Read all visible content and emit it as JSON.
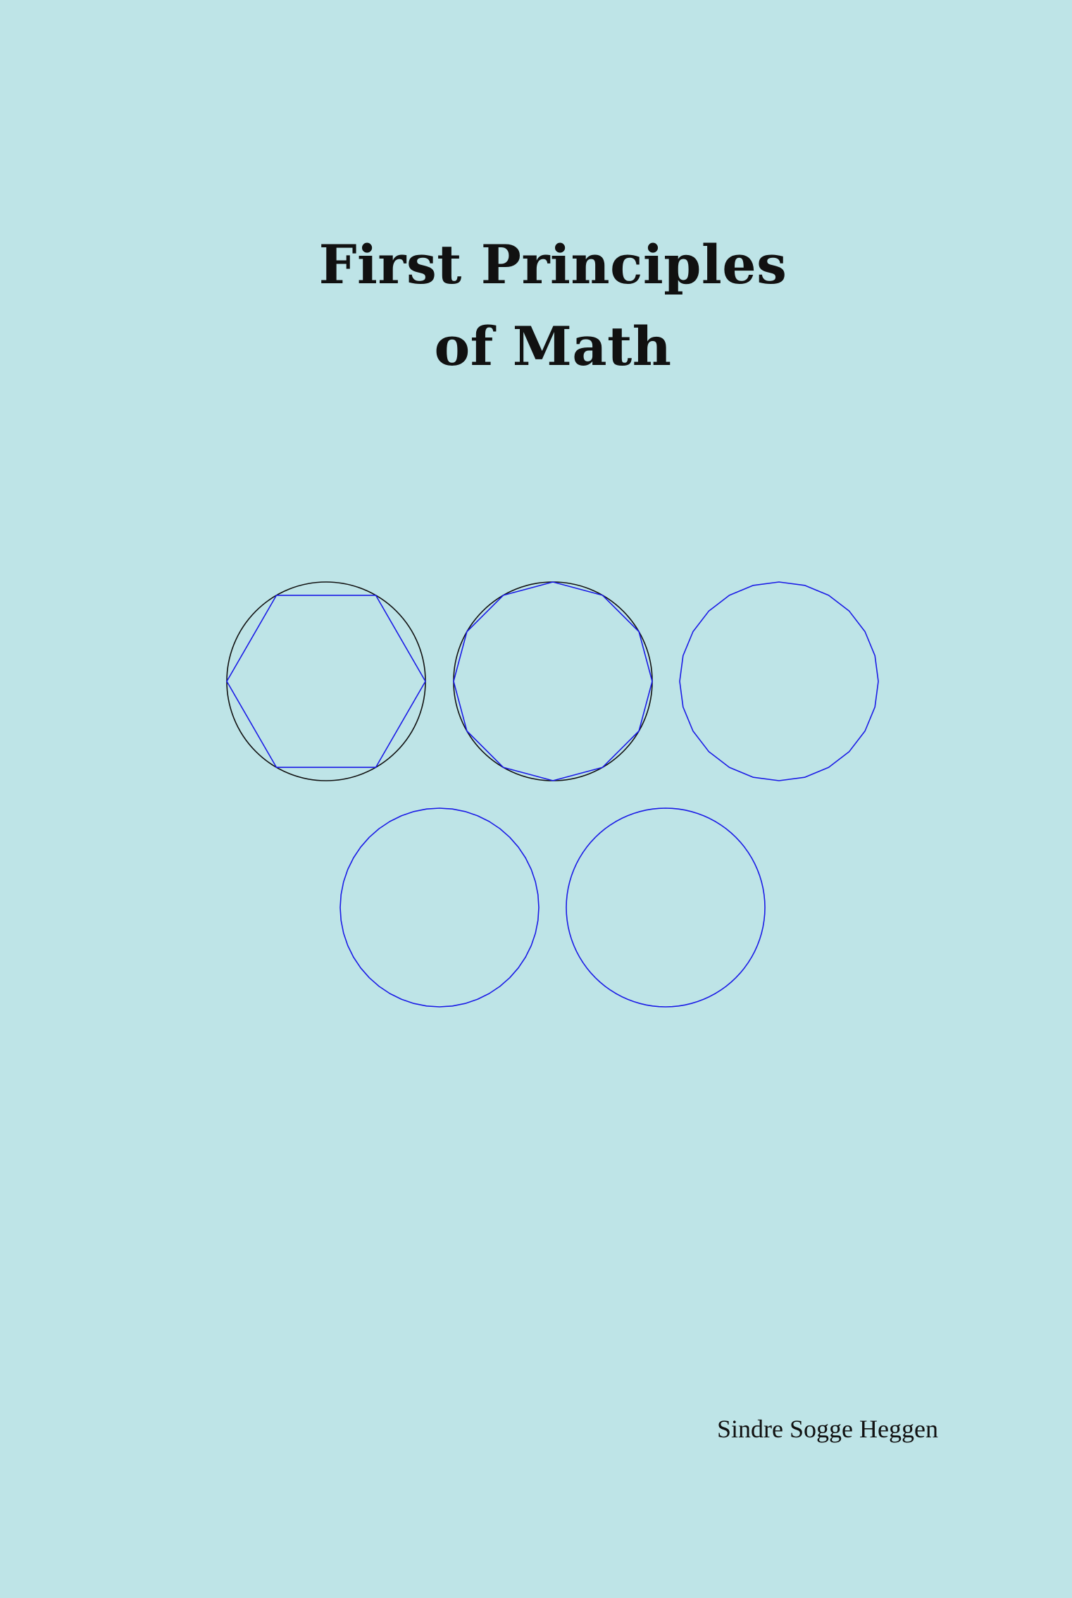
{
  "cover": {
    "background": "#bee4e7",
    "title_lines": [
      "First Principles",
      "of Math"
    ],
    "author": "Sindre Sogge Heggen"
  },
  "illustration": {
    "description_colors": {
      "polygon": "#1a1ae6",
      "circle": "#111111"
    },
    "shapes": [
      {
        "sides": 6,
        "circumscribed_circle": true
      },
      {
        "sides": 12,
        "circumscribed_circle": true
      },
      {
        "sides": 24,
        "circumscribed_circle": false
      },
      {
        "sides": 48,
        "circumscribed_circle": false
      },
      {
        "sides": 96,
        "circumscribed_circle": false
      }
    ]
  }
}
